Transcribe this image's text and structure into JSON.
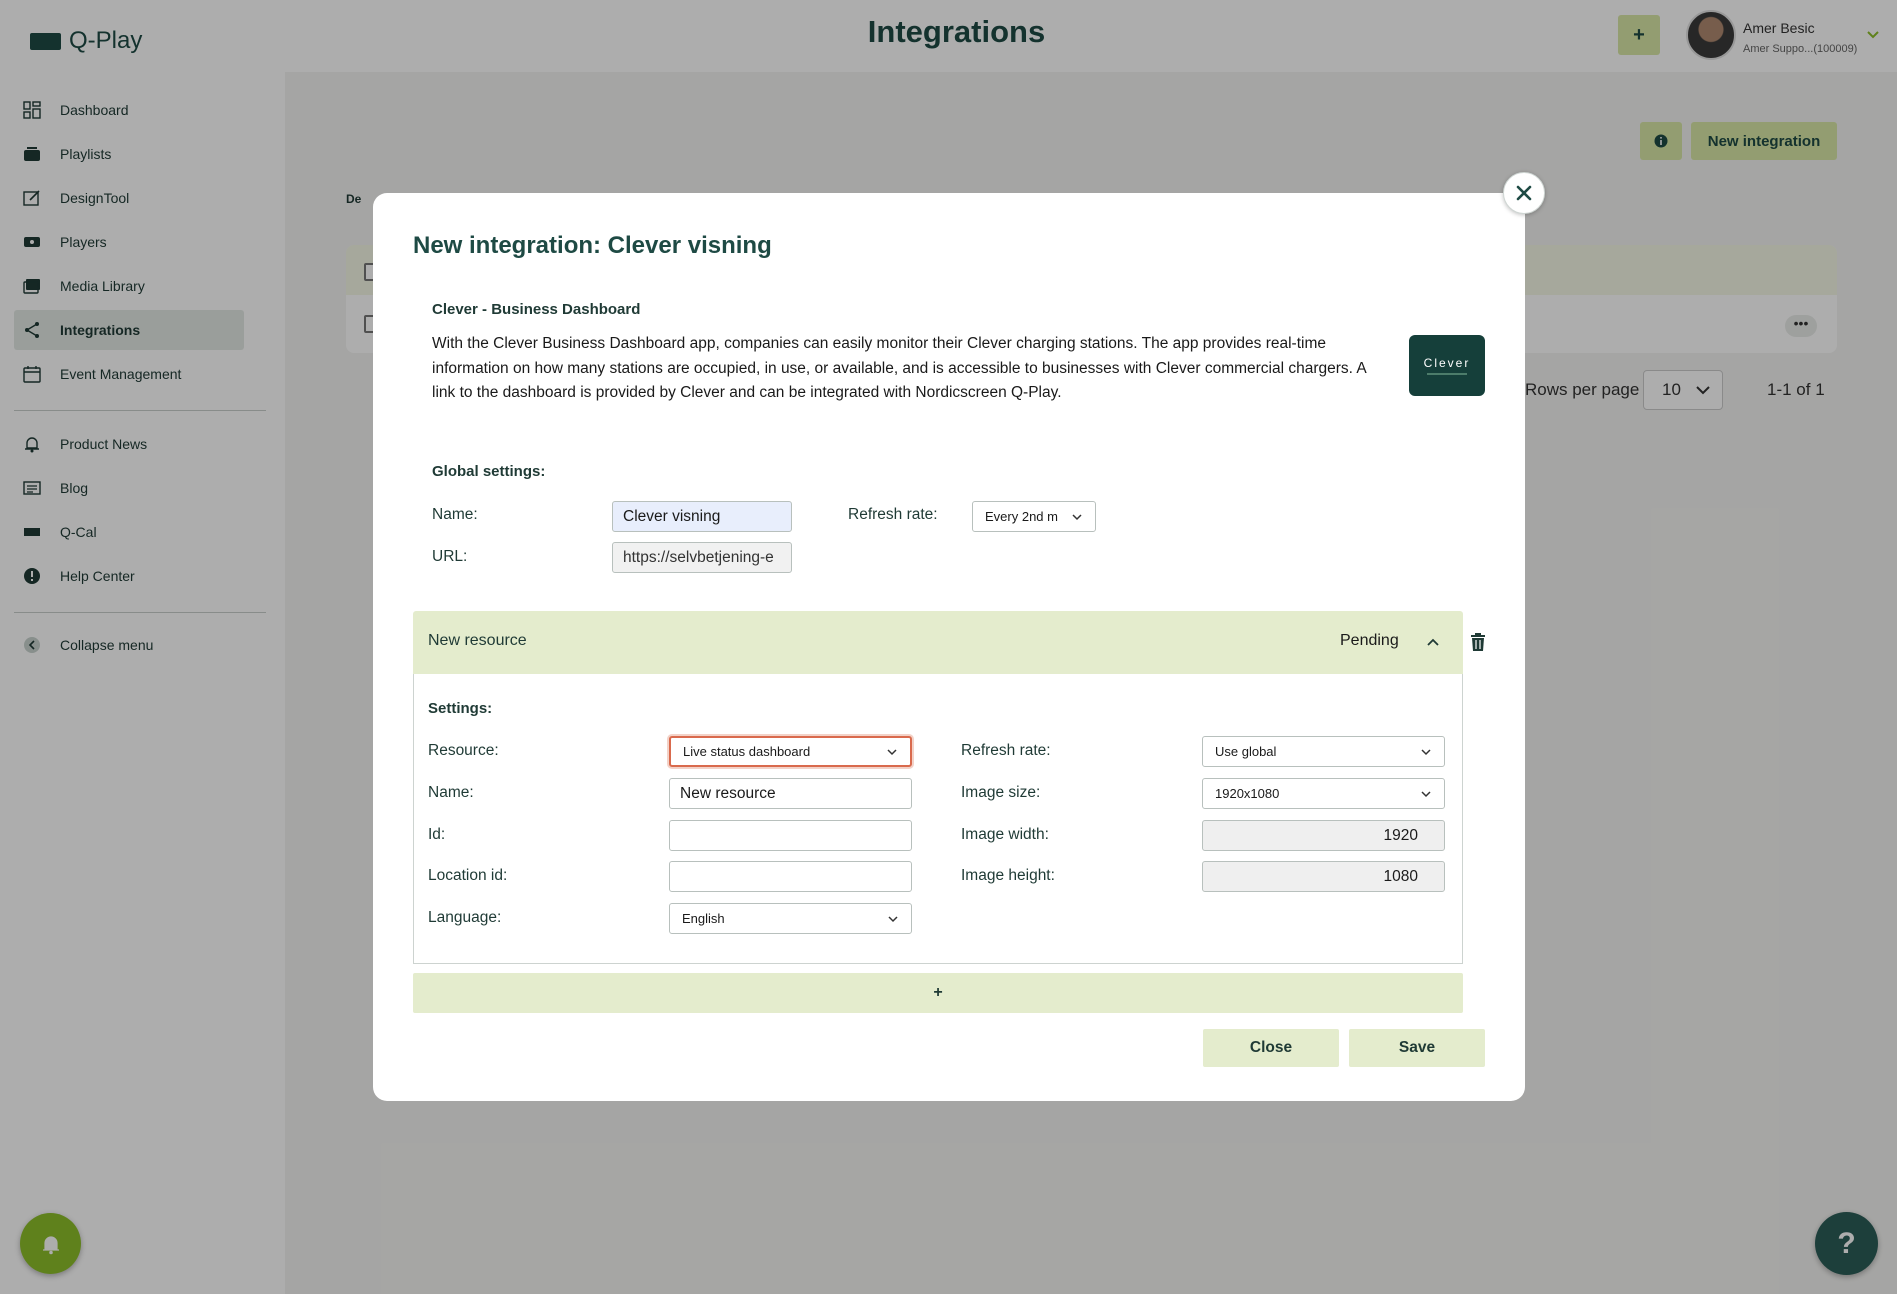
{
  "app": {
    "logo_text": "Q-Play",
    "page_title": "Integrations"
  },
  "topbar": {
    "add_label": "+",
    "user_name": "Amer Besic",
    "user_sub": "Amer Suppo...(100009)"
  },
  "sidebar": {
    "items": [
      {
        "label": "Dashboard",
        "icon": "dashboard-icon"
      },
      {
        "label": "Playlists",
        "icon": "playlists-icon"
      },
      {
        "label": "DesignTool",
        "icon": "designtool-icon"
      },
      {
        "label": "Players",
        "icon": "players-icon"
      },
      {
        "label": "Media Library",
        "icon": "media-library-icon"
      },
      {
        "label": "Integrations",
        "icon": "integrations-icon",
        "active": true
      },
      {
        "label": "Event Management",
        "icon": "calendar-icon"
      },
      {
        "label": "Product News",
        "icon": "bell-icon"
      },
      {
        "label": "Blog",
        "icon": "blog-icon"
      },
      {
        "label": "Q-Cal",
        "icon": "qcal-icon"
      },
      {
        "label": "Help Center",
        "icon": "help-icon"
      },
      {
        "label": "Collapse menu",
        "icon": "chevron-left-icon"
      }
    ]
  },
  "background": {
    "new_integration_label": "New integration",
    "tab_fragment": "De",
    "rows_per_page_label": "Rows per page",
    "rows_per_page_value": "10",
    "range": "1-1 of 1",
    "dots": "•••"
  },
  "modal": {
    "title": "New integration: Clever visning",
    "subtitle": "Clever - Business Dashboard",
    "description": "With the Clever Business Dashboard app, companies can easily monitor their Clever charging stations. The app provides real-time information on how many stations are occupied, in use, or available, and is accessible to businesses with Clever commercial chargers. A link to the dashboard is provided by Clever and can be integrated with Nordicscreen Q-Play.",
    "logo_text": "Clever",
    "global_settings_label": "Global settings:",
    "global": {
      "name_label": "Name:",
      "name_value": "Clever visning",
      "url_label": "URL:",
      "url_value": "https://selvbetjening-e",
      "refresh_label": "Refresh rate:",
      "refresh_value": "Every 2nd m"
    },
    "resource": {
      "title": "New resource",
      "status": "Pending",
      "settings_label": "Settings:",
      "resource_label": "Resource:",
      "resource_value": "Live status dashboard",
      "name_label": "Name:",
      "name_value": "New resource",
      "id_label": "Id:",
      "id_value": "",
      "location_label": "Location id:",
      "location_value": "",
      "language_label": "Language:",
      "language_value": "English",
      "refresh_label": "Refresh rate:",
      "refresh_value": "Use global",
      "image_size_label": "Image size:",
      "image_size_value": "1920x1080",
      "image_width_label": "Image width:",
      "image_width_value": "1920",
      "image_height_label": "Image height:",
      "image_height_value": "1080"
    },
    "add_resource_label": "+",
    "close_label": "Close",
    "save_label": "Save"
  },
  "colors": {
    "brand": "#1e4a44",
    "accent": "#d9e8a7",
    "resource_bg": "#e4eccd",
    "focus": "#d96a4d",
    "bell": "#8cbf2a",
    "help": "#2b5d57"
  }
}
